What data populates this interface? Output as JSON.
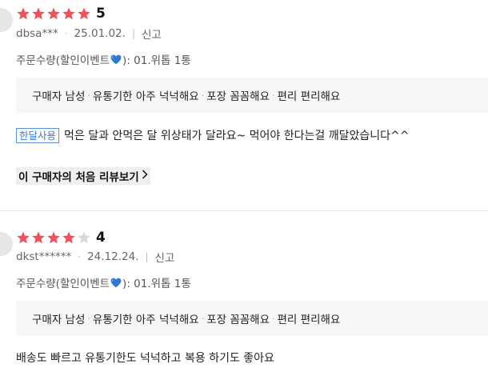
{
  "reviews": [
    {
      "rating": 5,
      "score_label": "5",
      "user": "dbsa***",
      "date": "25.01.02.",
      "report_label": "신고",
      "order_prefix": "주문수량(할인이벤트",
      "order_suffix": "): 01.위톱 1통",
      "tags": [
        "구매자 남성",
        "유통기한 아주 넉넉해요",
        "포장 꼼꼼해요",
        "편리 편리해요"
      ],
      "badge": "한달사용",
      "content": "먹은 달과 안먹은 달 위상태가 달라요~ 먹어야 한다는걸 깨달았습니다^^",
      "first_review_label": "이 구매자의 처음 리뷰보기"
    },
    {
      "rating": 4,
      "score_label": "4",
      "user": "dkst******",
      "date": "24.12.24.",
      "report_label": "신고",
      "order_prefix": "주문수량(할인이벤트",
      "order_suffix": "): 01.위톱 1통",
      "tags": [
        "구매자 남성",
        "유통기한 아주 넉넉해요",
        "포장 꼼꼼해요",
        "편리 편리해요"
      ],
      "content": "배송도 빠르고 유통기한도 넉넉하고 복용 하기도 좋아요"
    }
  ],
  "colors": {
    "star_on": "#f0505a",
    "star_off": "#d9d9d9",
    "badge": "#3f7ad0",
    "heart": "#2f7ad6"
  },
  "icons": {
    "star": "star-icon",
    "heart": "blue-heart-icon",
    "chevron": "chevron-right-icon"
  }
}
